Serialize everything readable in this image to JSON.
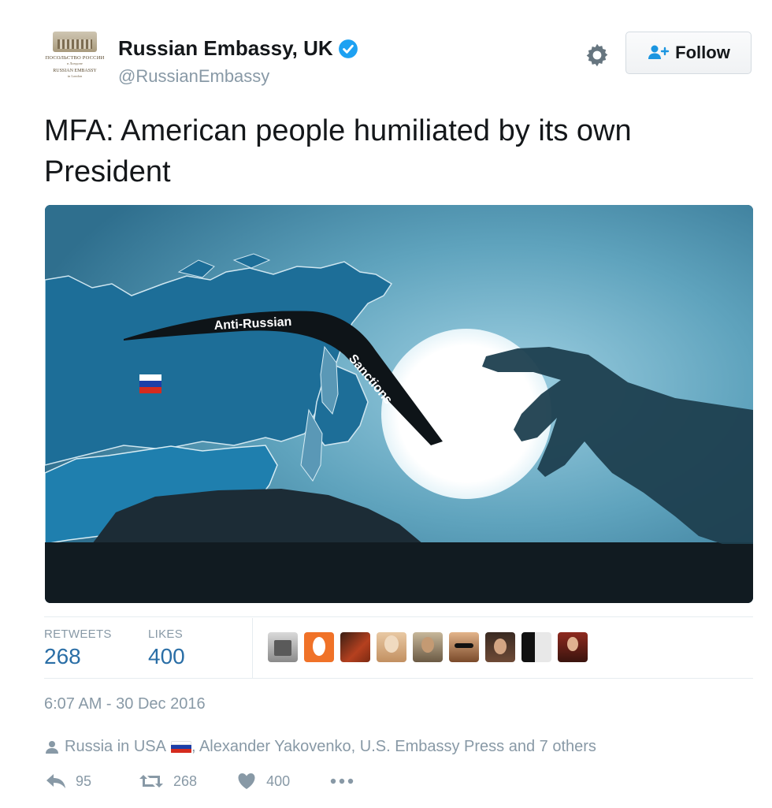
{
  "account": {
    "avatar_lines": [
      "ПОСОЛЬСТВО РОССИИ",
      "в Лондоне",
      "RUSSIAN EMBASSY",
      "in London"
    ],
    "display_name": "Russian Embassy, UK",
    "handle": "@RussianEmbassy",
    "verified": true
  },
  "header": {
    "follow_label": "Follow"
  },
  "tweet": {
    "text_line1": "MFA: American people humiliated by its own",
    "text_line2": "President"
  },
  "media": {
    "boomerang_text_1": "Anti-Russian",
    "boomerang_text_2": "Sanctions"
  },
  "stats": {
    "retweets_label": "RETWEETS",
    "retweets": "268",
    "likes_label": "LIKES",
    "likes": "400"
  },
  "timestamp": "6:07 AM - 30 Dec 2016",
  "mentions": {
    "prefix": "Russia in USA",
    "rest": ", Alexander Yakovenko, U.S. Embassy Press and 7 others"
  },
  "actions": {
    "replies": "95",
    "retweets": "268",
    "likes": "400"
  },
  "colors": {
    "link_blue": "#2a6ea6",
    "muted_gray": "#8899a6",
    "verified_blue": "#1da1f2",
    "ocean": "#4f95af",
    "land": "#1d6e98"
  }
}
